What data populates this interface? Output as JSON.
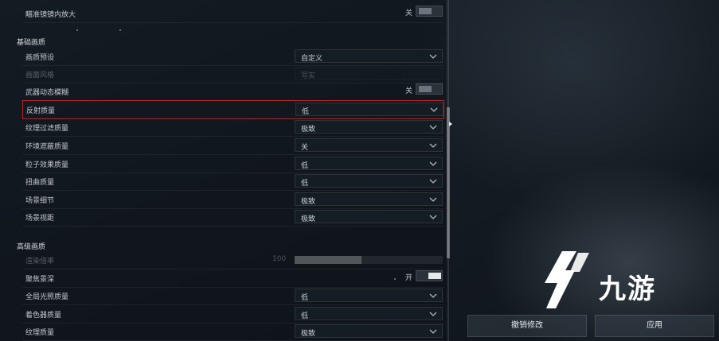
{
  "top_row": {
    "label": "瞄准镜镜内放大",
    "toggle_text": "关",
    "toggle_on": false
  },
  "sections": {
    "basic_title": "基础画质",
    "advanced_title": "高级画质"
  },
  "basic_rows": [
    {
      "label": "画质预设",
      "type": "dropdown",
      "value": "自定义"
    },
    {
      "label": "画面风格",
      "type": "dropdown",
      "value": "写实",
      "disabled": true
    },
    {
      "label": "武器动态模糊",
      "type": "toggle",
      "value": "关",
      "toggle_on": false
    },
    {
      "label": "反射质量",
      "type": "dropdown",
      "value": "低",
      "highlight": true
    },
    {
      "label": "纹理过滤质量",
      "type": "dropdown",
      "value": "极致"
    },
    {
      "label": "环境遮蔽质量",
      "type": "dropdown",
      "value": "关"
    },
    {
      "label": "粒子效果质量",
      "type": "dropdown",
      "value": "低"
    },
    {
      "label": "扭曲质量",
      "type": "dropdown",
      "value": "低"
    },
    {
      "label": "场景细节",
      "type": "dropdown",
      "value": "极致"
    },
    {
      "label": "场景视距",
      "type": "dropdown",
      "value": "极致"
    }
  ],
  "advanced_rows": [
    {
      "label": "渲染倍率",
      "type": "slider",
      "value": "100",
      "fill_fraction": 0.45,
      "disabled": true
    },
    {
      "label": "聚焦景深",
      "type": "toggle",
      "value": "开",
      "toggle_on": true
    },
    {
      "label": "全局光照质量",
      "type": "dropdown",
      "value": "低"
    },
    {
      "label": "着色器质量",
      "type": "dropdown",
      "value": "低"
    },
    {
      "label": "纹理质量",
      "type": "dropdown",
      "value": "极致"
    }
  ],
  "buttons": {
    "revert": "撤销修改",
    "apply": "应用"
  },
  "watermark": {
    "text": "九游"
  },
  "colors": {
    "highlight": "#b3262a",
    "logo_accent": "#ffffff"
  }
}
